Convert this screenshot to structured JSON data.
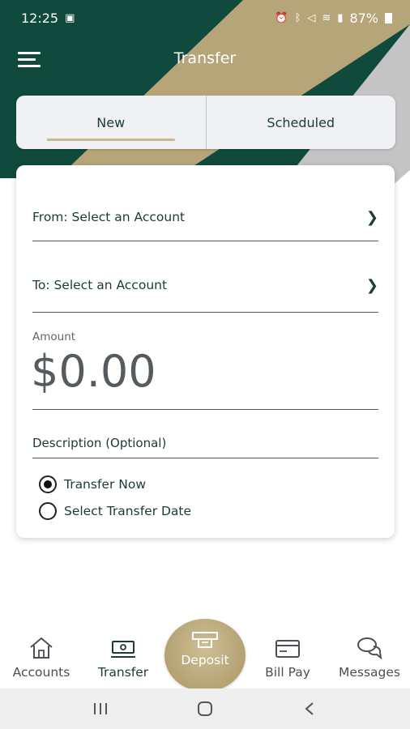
{
  "status_bar": {
    "time": "12:25",
    "battery_percent": "87%"
  },
  "header": {
    "title": "Transfer",
    "menu_icon": "hamburger-menu-icon"
  },
  "tabs": [
    {
      "label": "New",
      "active": true
    },
    {
      "label": "Scheduled",
      "active": false
    }
  ],
  "form": {
    "from_label": "From: Select an Account",
    "to_label": "To: Select an Account",
    "amount_label": "Amount",
    "amount_value": "$0.00",
    "description_placeholder": "Description (Optional)",
    "options": [
      {
        "label": "Transfer Now",
        "selected": true
      },
      {
        "label": "Select Transfer Date",
        "selected": false
      }
    ]
  },
  "bottom_nav": {
    "accounts": "Accounts",
    "transfer": "Transfer",
    "deposit": "Deposit",
    "bill_pay": "Bill Pay",
    "messages": "Messages"
  },
  "colors": {
    "brand_green": "#0f4a3c",
    "brand_gold": "#b7a57a",
    "brand_gray": "#c4c4c4"
  }
}
